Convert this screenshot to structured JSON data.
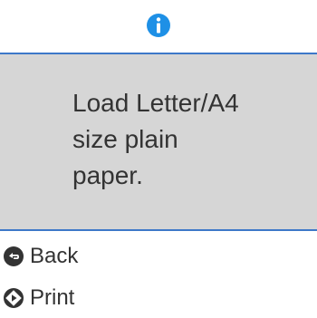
{
  "header": {
    "icon": "info-icon"
  },
  "message": {
    "text": "Load Letter/A4\nsize plain\npaper."
  },
  "actions": {
    "back": {
      "label": "Back",
      "icon": "back-icon"
    },
    "print": {
      "label": "Print",
      "icon": "start-icon"
    }
  },
  "colors": {
    "accent": "#3d78c8",
    "info_icon": "#1e90e6",
    "panel_background": "#d6d6d6",
    "text": "#333333"
  }
}
